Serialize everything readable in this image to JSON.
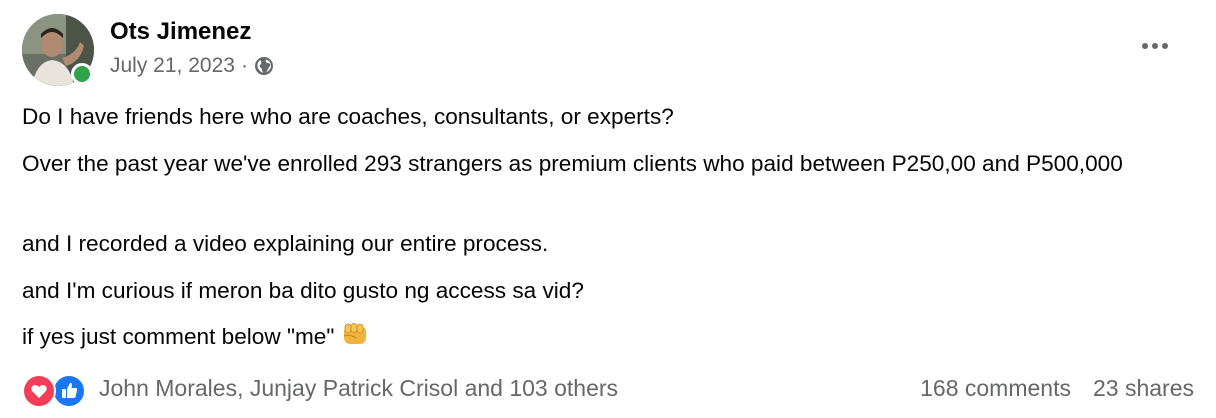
{
  "post": {
    "author": "Ots Jimenez",
    "date": "July 21, 2023",
    "separator": "·",
    "privacy_icon": "globe-icon",
    "online_status_color": "#31a24c",
    "more_icon": "more-horizontal-icon",
    "body": [
      "Do I have friends here who are coaches, consultants, or experts?",
      "Over the past year we've enrolled 293 strangers as premium clients who paid between P250,00 and P500,000",
      "and I recorded a video explaining our entire process.",
      "and I'm curious if meron ba dito gusto ng access sa vid?",
      "if yes just comment below \"me\""
    ],
    "body_emoji": "oncoming-fist-emoji"
  },
  "footer": {
    "reaction_icons": [
      "love-icon",
      "like-icon"
    ],
    "reactors_text": "John Morales, Junjay Patrick Crisol and 103 others",
    "comments": "168 comments",
    "shares": "23 shares"
  },
  "colors": {
    "text_primary": "#050505",
    "text_secondary": "#65676b",
    "love": "#f33e58",
    "like": "#1877f2"
  }
}
